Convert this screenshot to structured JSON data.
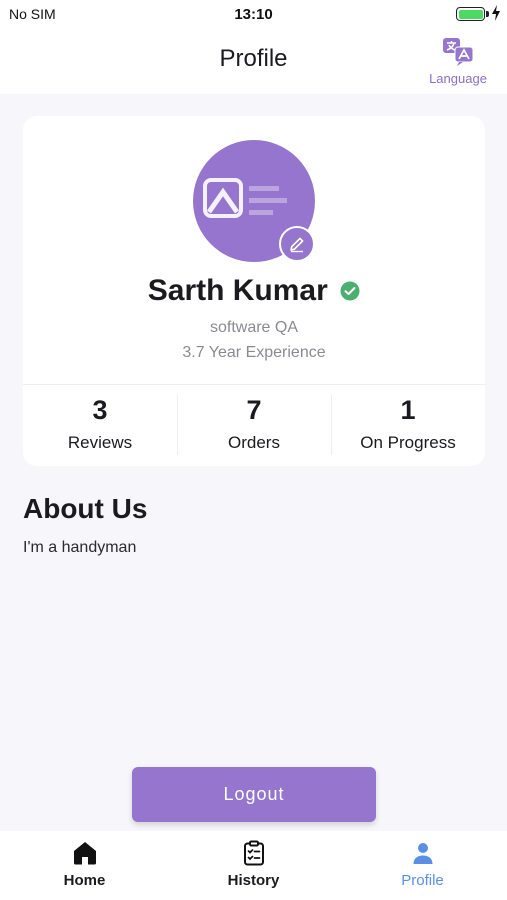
{
  "status_bar": {
    "carrier": "No SIM",
    "time": "13:10",
    "battery_level": 1.0,
    "battery_color": "#4cd964"
  },
  "header": {
    "title": "Profile",
    "language_label": "Language",
    "language_icon": "translate-icon"
  },
  "profile": {
    "name": "Sarth Kumar",
    "verified": true,
    "verified_icon": "check-circle-icon",
    "verified_color": "#4caf72",
    "role": "software QA",
    "experience": "3.7 Year Experience",
    "edit_icon": "pencil-icon",
    "stats": [
      {
        "value": "3",
        "label": "Reviews"
      },
      {
        "value": "7",
        "label": "Orders"
      },
      {
        "value": "1",
        "label": "On Progress"
      }
    ]
  },
  "about": {
    "title": "About Us",
    "text": "I'm a handyman"
  },
  "logout_label": "Logout",
  "bottom_nav": [
    {
      "label": "Home",
      "icon": "home-icon",
      "active": false
    },
    {
      "label": "History",
      "icon": "clipboard-icon",
      "active": false
    },
    {
      "label": "Profile",
      "icon": "person-icon",
      "active": true
    }
  ],
  "colors": {
    "accent": "#9575cd",
    "active_nav": "#5a8fe6",
    "background": "#f7f7fb"
  }
}
